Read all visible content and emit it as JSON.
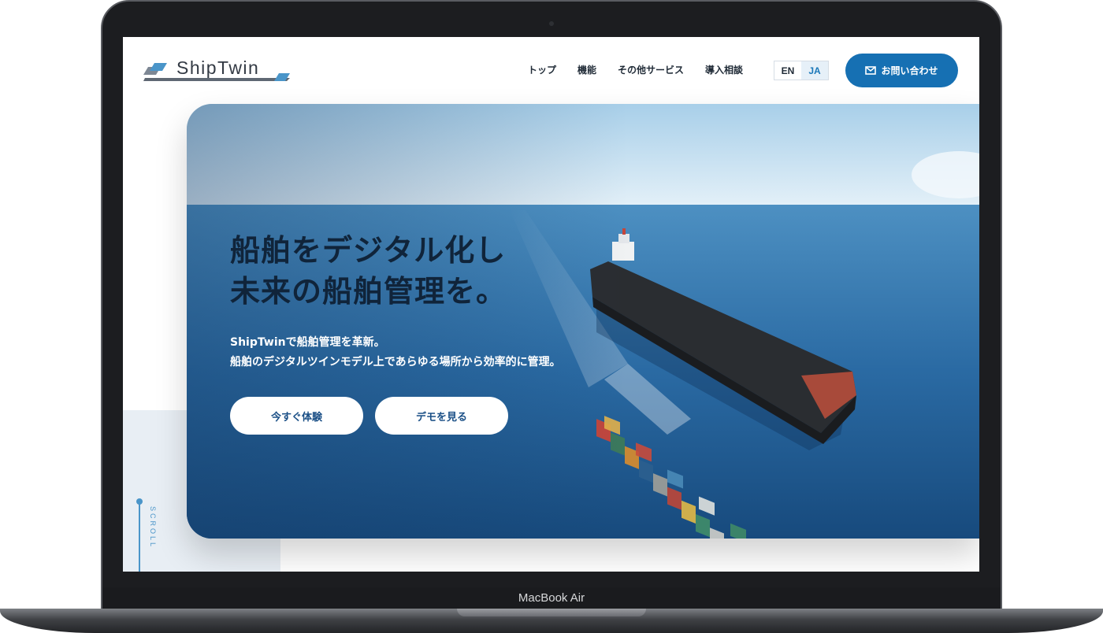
{
  "device": {
    "label": "MacBook Air"
  },
  "header": {
    "logo_text": "ShipTwin",
    "nav": [
      "トップ",
      "機能",
      "その他サービス",
      "導入相談"
    ],
    "lang": {
      "en": "EN",
      "ja": "JA",
      "selected": "JA"
    },
    "contact_label": "お問い合わせ",
    "contact_icon": "mail-icon"
  },
  "hero": {
    "title_line1": "船舶をデジタル化し",
    "title_line2": "未来の船舶管理を。",
    "subtitle_line1": "ShipTwinで船舶管理を革新。",
    "subtitle_line2": "船舶のデジタルツインモデル上であらゆる場所から効率的に管理。",
    "primary_button": "今すぐ体験",
    "secondary_button": "デモを見る"
  },
  "scroll": {
    "label": "SCROLL"
  },
  "colors": {
    "accent": "#1670b3",
    "title": "#10243a",
    "sea": "#2c6ea7"
  }
}
